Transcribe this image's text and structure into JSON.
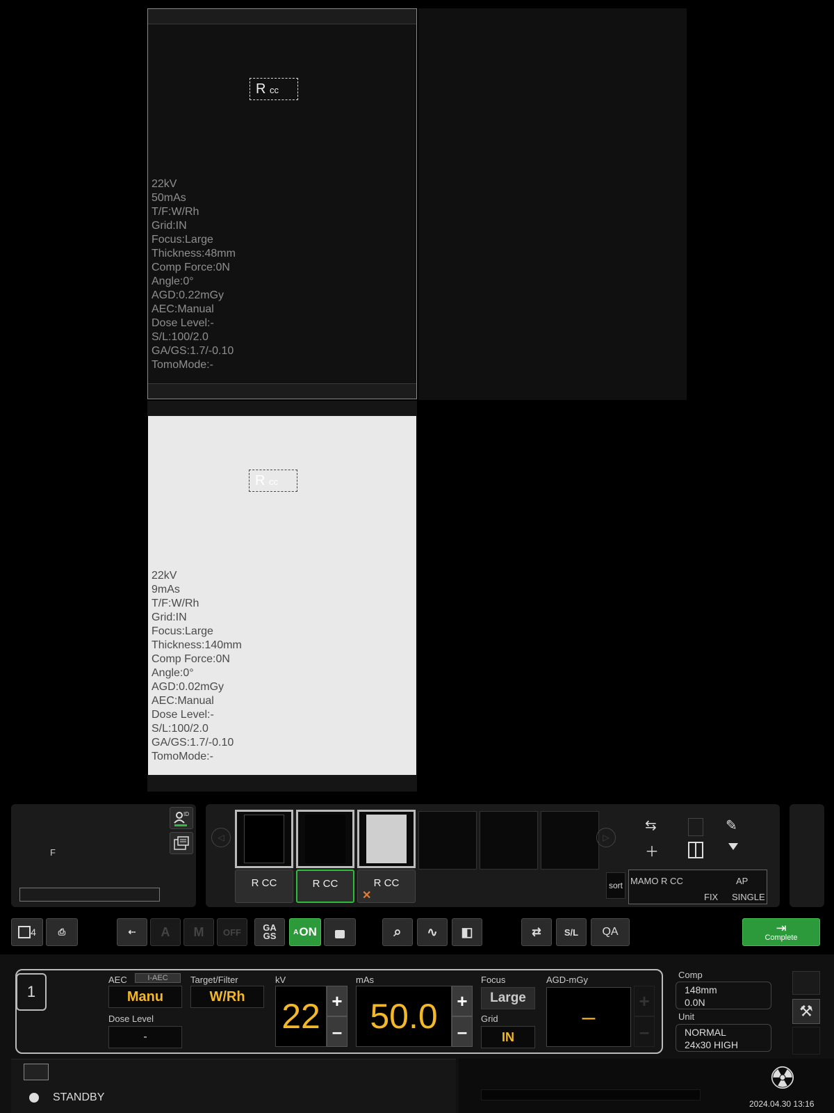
{
  "viewer": {
    "image1": {
      "marker_r": "R",
      "marker_cc": "cc",
      "lines": [
        "22kV",
        "50mAs",
        "T/F:W/Rh",
        "Grid:IN",
        "Focus:Large",
        "Thickness:48mm",
        "Comp Force:0N",
        "Angle:0°",
        "AGD:0.22mGy",
        "AEC:Manual",
        "Dose Level:-",
        "S/L:100/2.0",
        "GA/GS:1.7/-0.10",
        "TomoMode:-"
      ]
    },
    "image2": {
      "marker_r": "R",
      "marker_cc": "cc",
      "lines": [
        "22kV",
        "9mAs",
        "T/F:W/Rh",
        "Grid:IN",
        "Focus:Large",
        "Thickness:140mm",
        "Comp Force:0N",
        "Angle:0°",
        "AGD:0.02mGy",
        "AEC:Manual",
        "Dose Level:-",
        "S/L:100/2.0",
        "GA/GS:1.7/-0.10",
        "TomoMode:-"
      ]
    }
  },
  "patient": {
    "sex": "F",
    "name_field": ""
  },
  "thumbnails": [
    {
      "label": "R CC",
      "state": "dark-selected"
    },
    {
      "label": "R CC",
      "state": "current"
    },
    {
      "label": "R CC",
      "state": "light-rejected"
    },
    {
      "label": "",
      "state": "empty"
    },
    {
      "label": "",
      "state": "empty"
    },
    {
      "label": "",
      "state": "empty"
    }
  ],
  "protocol": {
    "sort_label": "sort",
    "name": "MAMO R CC",
    "position": "AP",
    "mode": "FIX",
    "count": "SINGLE"
  },
  "toolbar": {
    "layout_num": "4",
    "ga_gs_top": "GA",
    "ga_gs_bot": "GS",
    "a_on": "ON",
    "sl": "S/L",
    "qa": "QA",
    "complete": "Complete",
    "off": "OFF"
  },
  "control": {
    "slot": "1",
    "aec_label": "AEC",
    "iaec_label": "I-AEC",
    "aec_value": "Manu",
    "tf_label": "Target/Filter",
    "tf_value": "W/Rh",
    "dose_label": "Dose Level",
    "dose_value": "-",
    "kv_label": "kV",
    "kv_value": "22",
    "mas_label": "mAs",
    "mas_value": "50.0",
    "focus_label": "Focus",
    "focus_value": "Large",
    "grid_label": "Grid",
    "grid_value": "IN",
    "agd_label": "AGD-mGy",
    "agd_value": "–"
  },
  "side": {
    "comp_label": "Comp",
    "thickness": "148mm",
    "force": "0.0N",
    "unit_label": "Unit",
    "unit_mode": "NORMAL",
    "unit_size": "24x30 HIGH"
  },
  "status": {
    "state": "STANDBY",
    "datetime": "2024.04.30 13:16"
  },
  "colors": {
    "accent_yellow": "#f2b829",
    "accent_green": "#2fbd3a"
  }
}
